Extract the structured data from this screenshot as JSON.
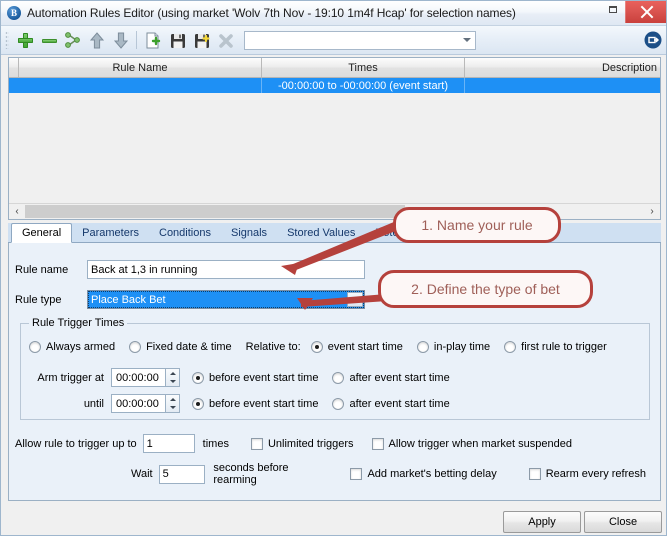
{
  "window": {
    "title": "Automation Rules Editor (using market 'Wolv 7th Nov - 19:10 1m4f Hcap' for selection names)",
    "app_icon": "bet-angel-b-icon",
    "restore_label": "",
    "close_label": ""
  },
  "toolbar": {
    "combo_value": "",
    "buttons": [
      {
        "name": "add-rule-button",
        "icon": "plus-icon"
      },
      {
        "name": "remove-rule-button",
        "icon": "minus-icon"
      },
      {
        "name": "branch-rule-button",
        "icon": "branch-icon"
      },
      {
        "name": "move-up-button",
        "icon": "arrow-up-icon"
      },
      {
        "name": "move-down-button",
        "icon": "arrow-down-icon"
      },
      {
        "name": "new-file-button",
        "icon": "new-document-icon"
      },
      {
        "name": "save-button",
        "icon": "save-disk-icon"
      },
      {
        "name": "save-as-button",
        "icon": "save-as-disk-icon"
      },
      {
        "name": "delete-button",
        "icon": "delete-x-icon"
      },
      {
        "name": "pin-button",
        "icon": "pin-icon"
      }
    ]
  },
  "rules_list": {
    "columns": [
      "Rule Name",
      "Times",
      "Description"
    ],
    "rows": [
      {
        "rule_name": "",
        "times": "-00:00:00 to -00:00:00 (event start)",
        "description": ""
      }
    ],
    "scroll_left_label": "‹",
    "scroll_right_label": "›"
  },
  "tabs": [
    {
      "label": "General",
      "active": true
    },
    {
      "label": "Parameters",
      "active": false
    },
    {
      "label": "Conditions",
      "active": false
    },
    {
      "label": "Signals",
      "active": false
    },
    {
      "label": "Stored Values",
      "active": false
    },
    {
      "label": "Notes",
      "active": false
    }
  ],
  "general": {
    "rule_name_label": "Rule name",
    "rule_name_value": "Back at 1,3 in running",
    "rule_type_label": "Rule type",
    "rule_type_value": "Place Back Bet",
    "trigger_group_title": "Rule Trigger Times",
    "always_armed_label": "Always armed",
    "fixed_date_label": "Fixed date & time",
    "relative_to_label": "Relative to:",
    "relative_options": [
      {
        "label": "event start time",
        "selected": true
      },
      {
        "label": "in-play time",
        "selected": false
      },
      {
        "label": "first rule to trigger",
        "selected": false
      }
    ],
    "arm_trigger_label": "Arm trigger at",
    "arm_trigger_value": "00:00:00",
    "arm_before_label": "before event start time",
    "arm_after_label": "after event start time",
    "until_label": "until",
    "until_value": "00:00:00",
    "until_before_label": "before event start time",
    "until_after_label": "after event start time",
    "allow_trigger_prefix": "Allow rule to trigger up to",
    "allow_trigger_value": "1",
    "allow_trigger_suffix": "times",
    "unlimited_triggers_label": "Unlimited triggers",
    "allow_suspended_label": "Allow trigger when market suspended",
    "wait_label": "Wait",
    "wait_value": "5",
    "wait_suffix": "seconds before rearming",
    "betting_delay_label": "Add market's betting delay",
    "rearm_refresh_label": "Rearm every refresh"
  },
  "footer": {
    "apply_label": "Apply",
    "close_label": "Close"
  },
  "annotations": [
    {
      "text": "1. Name your rule"
    },
    {
      "text": "2. Define the type of bet"
    }
  ],
  "colors": {
    "selection_blue": "#1e90f5",
    "annotation_red": "#b5413c",
    "titlebar_close_red": "#d9534f",
    "tabstrip_blue": "#cfe0f2",
    "panel_blue": "#eaf1f9"
  }
}
